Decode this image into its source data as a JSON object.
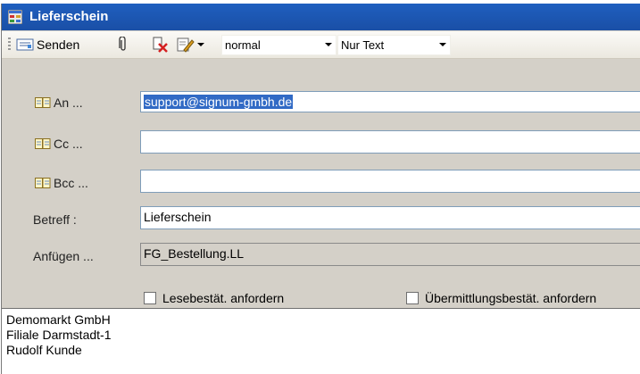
{
  "window": {
    "title": "Lieferschein"
  },
  "toolbar": {
    "send_label": "Senden",
    "format_value": "normal",
    "mode_value": "Nur Text"
  },
  "fields": {
    "to": {
      "label": "An ...",
      "value": "support@signum-gmbh.de"
    },
    "cc": {
      "label": "Cc ...",
      "value": ""
    },
    "bcc": {
      "label": "Bcc ...",
      "value": ""
    },
    "subject": {
      "label": "Betreff :",
      "value": "Lieferschein"
    },
    "attach": {
      "label": "Anfügen ...",
      "value": "FG_Bestellung.LL"
    }
  },
  "options": {
    "read_receipt": "Lesebestät. anfordern",
    "delivery_receipt": "Übermittlungsbestät. anfordern"
  },
  "body": {
    "lines": [
      "Demomarkt GmbH",
      "Filiale Darmstadt-1",
      "Rudolf Kunde"
    ]
  },
  "colors": {
    "titlebar": "#1f5fbf",
    "selection": "#316ac5",
    "window_bg": "#d4d0c8"
  }
}
